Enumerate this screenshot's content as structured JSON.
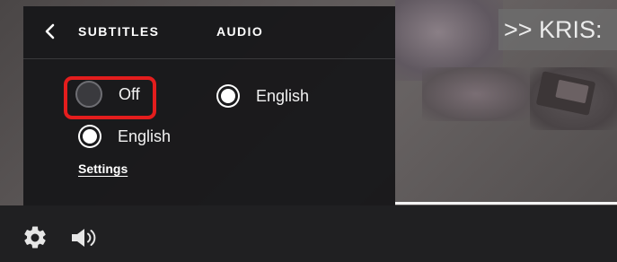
{
  "video": {
    "caption_text": ">> KRIS:"
  },
  "panel": {
    "tabs": [
      {
        "label": "SUBTITLES"
      },
      {
        "label": "AUDIO"
      }
    ],
    "subtitles": {
      "options": [
        {
          "label": "Off",
          "selected": false
        },
        {
          "label": "English",
          "selected": true
        }
      ],
      "settings_label": "Settings"
    },
    "audio": {
      "options": [
        {
          "label": "English",
          "selected": true
        }
      ]
    }
  },
  "controls": {
    "icons": [
      "gear-icon",
      "volume-icon"
    ]
  },
  "colors": {
    "panel_bg": "#18181a",
    "highlight": "#e41d1d",
    "text": "#ffffff",
    "progress": "#f4f4f4"
  }
}
